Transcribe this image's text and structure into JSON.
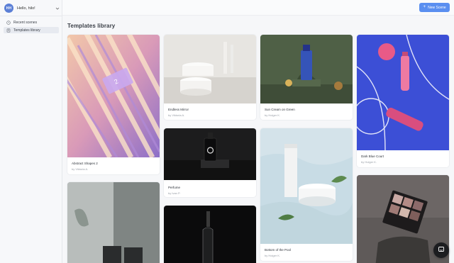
{
  "account": {
    "initials": "HH",
    "name": "Hello, hilo!"
  },
  "sidebar": {
    "items": [
      {
        "label": "Recent scenes",
        "icon": "clock-icon",
        "active": false
      },
      {
        "label": "Templates library",
        "icon": "book-icon",
        "active": true
      }
    ]
  },
  "toolbar": {
    "new_scene_label": "New Scene"
  },
  "page": {
    "title": "Templates library"
  },
  "templates": [
    {
      "title": "Abstract Shapes 2",
      "author": "by Viktoria A."
    },
    {
      "title": "Endless Mirror",
      "author": "by Viktoria A."
    },
    {
      "title": "Sun Cream on Green",
      "author": "by Holger K."
    },
    {
      "title": "Dark Blue Court",
      "author": "by Holger K."
    },
    {
      "title": "Perfume",
      "author": "by Ivan P."
    },
    {
      "title": "Bottom of the Pool",
      "author": "by Holger K."
    },
    {
      "title": "",
      "author": ""
    },
    {
      "title": "",
      "author": ""
    },
    {
      "title": "",
      "author": ""
    }
  ],
  "colors": {
    "accent": "#5a8ff0",
    "court": "#3c4fd6"
  }
}
